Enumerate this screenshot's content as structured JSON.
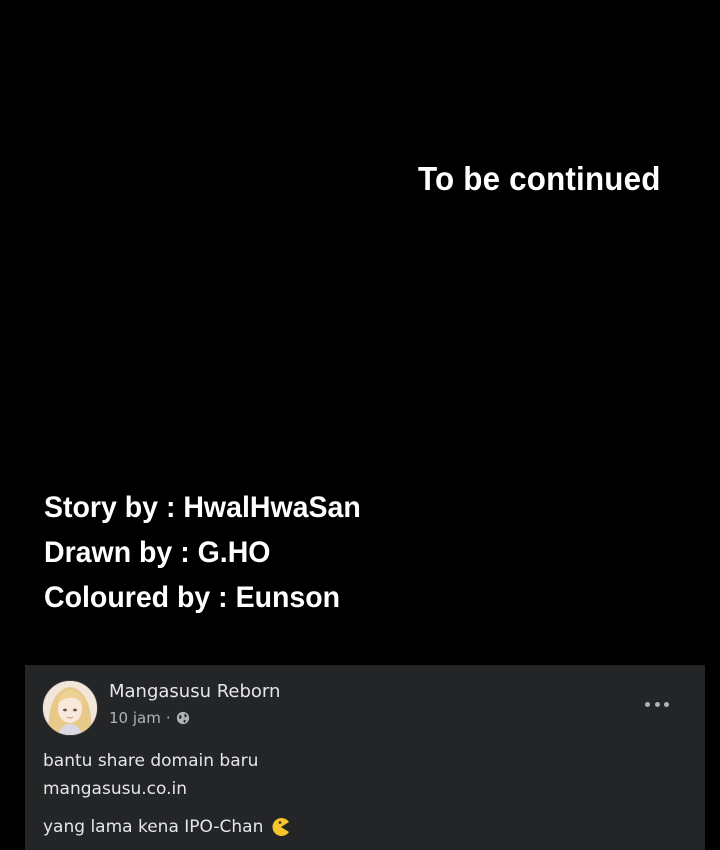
{
  "banner": {
    "continued": "To be continued"
  },
  "credits": {
    "story": "Story by : HwalHwaSan",
    "drawn": "Drawn by : G.HO",
    "coloured": "Coloured by : Eunson"
  },
  "post": {
    "author": "Mangasusu Reborn",
    "time": "10 jam",
    "separator": "·",
    "privacy_icon": "globe-icon",
    "menu_icon": "more-options-icon",
    "line1": "bantu share domain baru",
    "line2": "mangasusu.co.in",
    "line3": "yang lama kena IPO-Chan",
    "emoji": "pac-man-emoji"
  },
  "colors": {
    "page_background": "#000000",
    "post_background": "#242526",
    "primary_text": "#e4e6eb",
    "secondary_text": "#b0b3b8"
  }
}
